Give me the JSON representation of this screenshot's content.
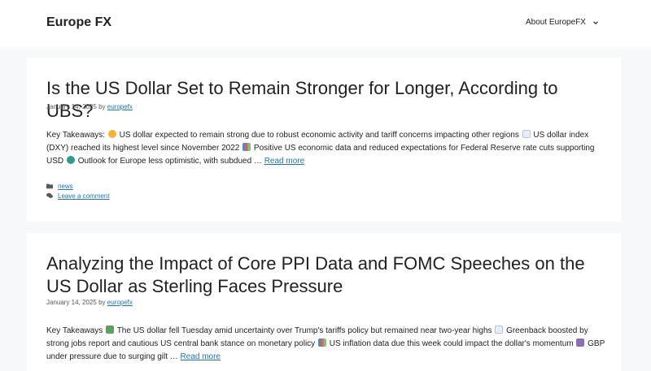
{
  "header": {
    "site_title": "Europe FX",
    "nav_label": "About EuropeFX"
  },
  "posts": [
    {
      "title": "Is the US Dollar Set to Remain Stronger for Longer, According to UBS?",
      "date": "January 14, 2025",
      "by": "by",
      "author": "europefx",
      "excerpt_parts": [
        "Key Takeaways:",
        "US dollar expected to remain strong due to robust economic activity and tariff concerns impacting other regions",
        "US dollar index (DXY) reached its highest level since November 2022",
        "Positive US economic data and reduced expectations for Federal Reserve rate cuts supporting USD",
        "Outlook for Europe less optimistic, with subdued …"
      ],
      "read_more": "Read more",
      "category": "news",
      "comment_link": "Leave a comment"
    },
    {
      "title": "Analyzing the Impact of Core PPI Data and FOMC Speeches on the US Dollar as Sterling Faces Pressure",
      "date": "January 14, 2025",
      "by": "by",
      "author": "europefx",
      "excerpt_parts": [
        "Key Takeaways",
        "The US dollar fell Tuesday amid uncertainty over Trump's tariffs policy but remained near two-year highs",
        "Greenback boosted by strong jobs report and cautious US central bank stance on monetary policy",
        "US inflation data due this week could impact the dollar's momentum",
        "GBP under pressure due to surging gilt …"
      ],
      "read_more": "Read more"
    }
  ],
  "icons": {
    "flexed_bicep": "flexed-biceps-emoji",
    "chart_up": "chart-increasing-emoji",
    "bar_chart": "bar-chart-emoji",
    "globe": "globe-emoji",
    "money": "dollar-banknote-emoji",
    "pound": "pound-banknote-emoji"
  },
  "colors": {
    "link": "#1e73be",
    "background": "#f7f8f9",
    "card": "#ffffff",
    "text": "#222222",
    "meta": "#595959"
  }
}
